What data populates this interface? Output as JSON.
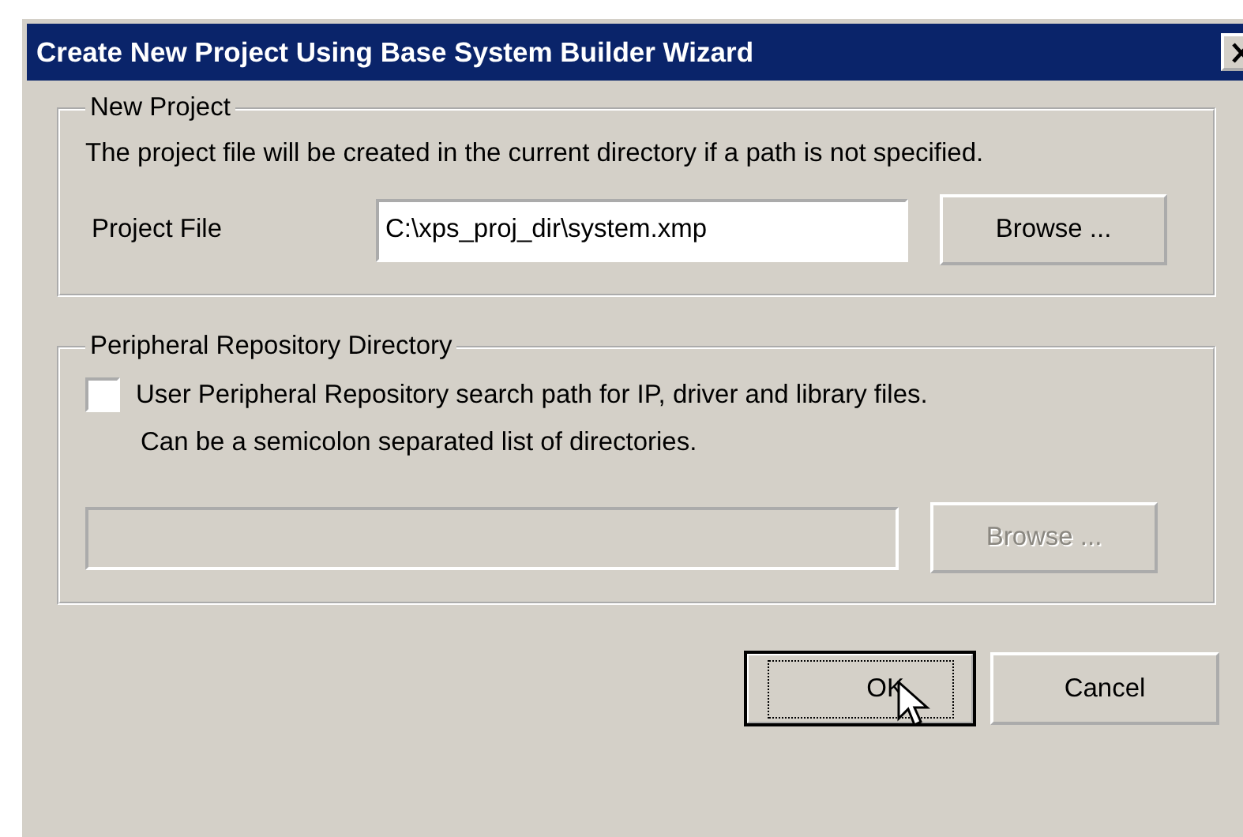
{
  "window": {
    "title": "Create New Project Using Base System Builder Wizard"
  },
  "groups": [
    {
      "legend": "New Project",
      "note": "The project file will be created in the current directory if a path is not specified.",
      "field_label": "Project File",
      "field": {
        "value": "C:\\xps_proj_dir\\system.xmp",
        "disabled": false
      },
      "browse": {
        "label": "Browse ...",
        "disabled": false
      }
    },
    {
      "legend": "Peripheral Repository Directory",
      "checkbox": {
        "label": "User Peripheral Repository search path for IP, driver and library files.",
        "checked": false
      },
      "note": "Can be a semicolon separated list of directories.",
      "field": {
        "disabled": true
      },
      "browse": {
        "label": "Browse ...",
        "disabled": true
      }
    }
  ],
  "buttons": [
    {
      "label": "OK",
      "default": true
    },
    {
      "label": "Cancel",
      "default": false
    }
  ]
}
